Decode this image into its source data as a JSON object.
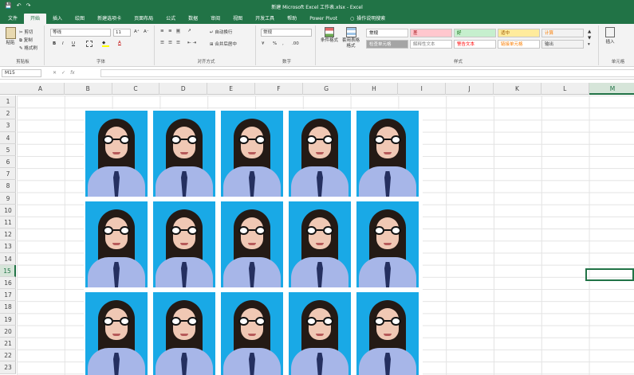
{
  "window": {
    "title": "新建 Microsoft Excel 工作表.xlsx - Excel",
    "qa_save": "💾",
    "qa_undo": "↶",
    "qa_redo": "↷"
  },
  "tabs": [
    {
      "label": "文件"
    },
    {
      "label": "开始"
    },
    {
      "label": "插入"
    },
    {
      "label": "绘图"
    },
    {
      "label": "新建选项卡"
    },
    {
      "label": "页面布局"
    },
    {
      "label": "公式"
    },
    {
      "label": "数据"
    },
    {
      "label": "审阅"
    },
    {
      "label": "视图"
    },
    {
      "label": "开发工具"
    },
    {
      "label": "帮助"
    },
    {
      "label": "Power Pivot"
    }
  ],
  "tell_me": "操作说明搜索",
  "ribbon": {
    "clipboard": {
      "paste": "粘贴",
      "cut": "剪切",
      "copy": "复制",
      "format_painter": "格式刷",
      "label": "剪贴板"
    },
    "font": {
      "name": "等线",
      "size": "11",
      "grow": "A⁺",
      "shrink": "A⁻",
      "bold": "B",
      "italic": "I",
      "underline": "U",
      "color": "A",
      "label": "字体"
    },
    "alignment": {
      "wrap": "自动换行",
      "merge": "合并后居中",
      "label": "对齐方式"
    },
    "number": {
      "format": "常规",
      "percent": "%",
      "comma": ",",
      "label": "数字"
    },
    "styles": {
      "conditional": "条件格式",
      "table": "套用表格格式",
      "cells": [
        {
          "label": "常规",
          "bg": "#ffffff",
          "fg": "#000000"
        },
        {
          "label": "差",
          "bg": "#ffc7ce",
          "fg": "#9c0006"
        },
        {
          "label": "好",
          "bg": "#c6efce",
          "fg": "#006100"
        },
        {
          "label": "适中",
          "bg": "#ffeb9c",
          "fg": "#9c5700"
        },
        {
          "label": "计算",
          "bg": "#f2f2f2",
          "fg": "#fa7d00"
        },
        {
          "label": "检查单元格",
          "bg": "#a5a5a5",
          "fg": "#ffffff"
        },
        {
          "label": "解释性文本",
          "bg": "#ffffff",
          "fg": "#7f7f7f"
        },
        {
          "label": "警告文本",
          "bg": "#ffffff",
          "fg": "#ff0000"
        },
        {
          "label": "链接单元格",
          "bg": "#ffffff",
          "fg": "#fa7d00"
        },
        {
          "label": "输出",
          "bg": "#f2f2f2",
          "fg": "#3f3f3f"
        }
      ],
      "label": "样式"
    },
    "cells_group": {
      "insert": "插入",
      "label": "单元格"
    }
  },
  "formula_bar": {
    "name_box": "M15",
    "cancel": "✕",
    "enter": "✓",
    "fx": "fx",
    "value": ""
  },
  "sheet": {
    "columns": [
      "A",
      "B",
      "C",
      "D",
      "E",
      "F",
      "G",
      "H",
      "I",
      "J",
      "K",
      "L",
      "M"
    ],
    "rows": [
      "1",
      "2",
      "3",
      "4",
      "5",
      "6",
      "7",
      "8",
      "9",
      "10",
      "11",
      "12",
      "13",
      "14",
      "15",
      "16",
      "17",
      "18",
      "19",
      "20",
      "21",
      "22",
      "23"
    ],
    "selected_column": "M",
    "selected_row": "15"
  },
  "photos": {
    "rows": 3,
    "cols": 5,
    "background": "#19a9e6"
  }
}
